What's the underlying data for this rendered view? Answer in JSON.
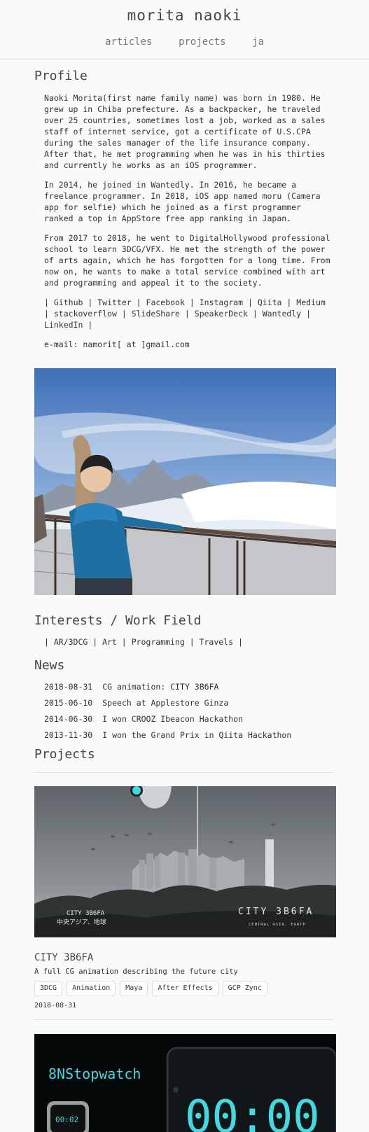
{
  "header": {
    "title": "morita naoki",
    "nav": [
      "articles",
      "projects",
      "ja"
    ]
  },
  "profile": {
    "heading": "Profile",
    "paragraphs": [
      "Naoki Morita(first name family name) was born in 1980. He\ngrew up in Chiba prefecture. As a backpacker, he traveled\nover 25 countries, sometimes lost a job, worked as a sales\nstaff of internet service, got a certificate of U.S.CPA\nduring the sales manager of the life insurance company.\nAfter that, he met programming when he was in his thirties\nand currently he works as an iOS programmer.",
      "In 2014, he joined in Wantedly. In 2016, he became a\nfreelance programmer. In 2018, iOS app named moru (Camera\napp for selfie) which he joined as a first programmer\nranked a top in AppStore free app ranking in Japan.",
      "From 2017 to 2018, he went to DigitalHollywood professional\nschool to learn 3DCG/VFX. He met the strength of the power\nof arts again, which he has forgotten for a long time. From\nnow on, he wants to make a total service combined with art\nand programming and appeal it to the society."
    ],
    "links": [
      "Github",
      "Twitter",
      "Facebook",
      "Instagram",
      "Qiita",
      "Medium",
      "stackoverflow",
      "SlideShare",
      "SpeakerDeck",
      "Wantedly",
      "LinkedIn"
    ],
    "separator": "|",
    "email": "e-mail: namorit[ at ]gmail.com"
  },
  "interests": {
    "heading": "Interests / Work Field",
    "text": "| AR/3DCG | Art | Programming | Travels |"
  },
  "news": {
    "heading": "News",
    "items": [
      {
        "date": "2018-08-31",
        "text": "CG animation: CITY 3B6FA"
      },
      {
        "date": "2015-06-10",
        "text": "Speech at Applestore Ginza"
      },
      {
        "date": "2014-06-30",
        "text": "I won CROOZ Ibeacon Hackathon"
      },
      {
        "date": "2013-11-30",
        "text": "I won the Grand Prix in Qiita Hackathon"
      }
    ]
  },
  "projects": {
    "heading": "Projects",
    "items": [
      {
        "title": "CITY 3B6FA",
        "description": "A full CG animation describing the future city",
        "tags": [
          "3DCG",
          "Animation",
          "Maya",
          "After Effects",
          "GCP Zync"
        ],
        "date": "2018-08-31",
        "thumb_text": {
          "left_line1": "CITY 3B6FA",
          "left_line2": "中央アジア、地球",
          "right_big": "CITY 3B6FA",
          "right_small": "CENTRAL ASIA, EARTH"
        }
      },
      {
        "thumb_text": {
          "title": "8NStopwatch",
          "timer": "00:00",
          "watch": "00:02"
        }
      }
    ]
  },
  "colors": {
    "accent_cyan": "#47d7e0",
    "text": "#333333",
    "background": "#fafafa"
  }
}
